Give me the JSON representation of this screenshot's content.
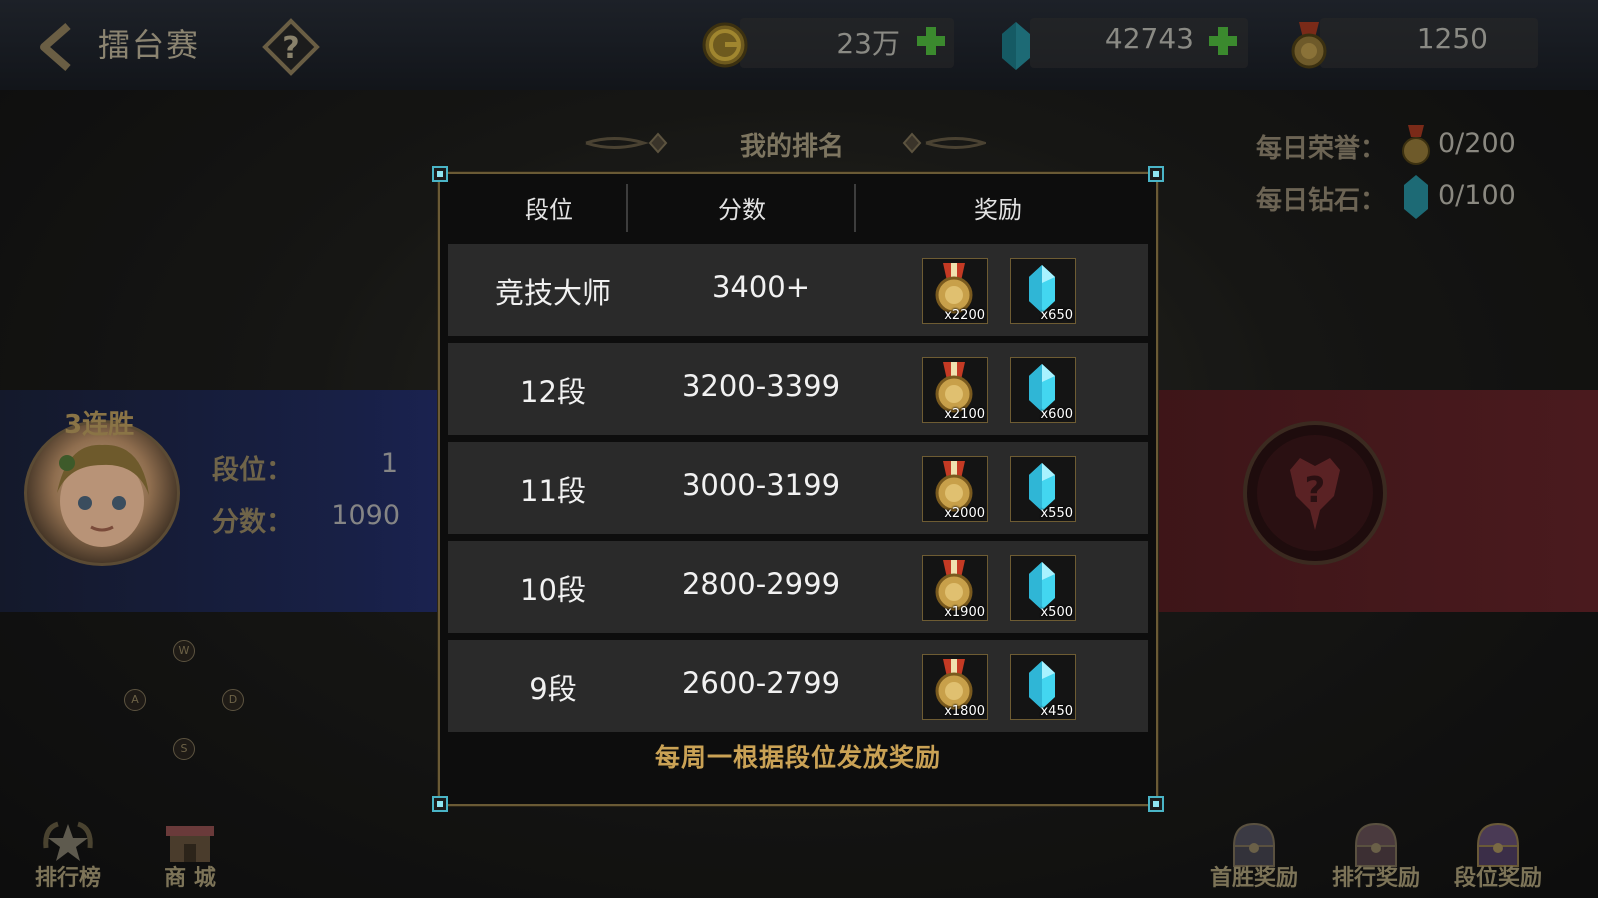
{
  "header": {
    "title": "擂台赛",
    "resources": [
      {
        "icon": "gold-coin-icon",
        "value": "23万"
      },
      {
        "icon": "diamond-icon",
        "value": "42743"
      },
      {
        "icon": "honor-medal-icon",
        "value": "1250"
      }
    ]
  },
  "ranking": {
    "title": "我的排名",
    "daily_honor_label": "每日荣誉：",
    "daily_honor_value": "0/200",
    "daily_diamond_label": "每日钻石：",
    "daily_diamond_value": "0/100"
  },
  "player": {
    "streak": "3连胜",
    "tier_label": "段位：",
    "tier_value": "1",
    "score_label": "分数：",
    "score_value": "1090"
  },
  "joystick": {
    "up": "W",
    "left": "A",
    "right": "D",
    "down": "S"
  },
  "bottom_nav": {
    "left": [
      {
        "label": "排行榜",
        "icon": "star-laurel-icon"
      },
      {
        "label": "商 城",
        "icon": "shop-icon"
      }
    ],
    "right": [
      {
        "label": "首胜奖励",
        "icon": "chest-icon"
      },
      {
        "label": "排行奖励",
        "icon": "chest-icon"
      },
      {
        "label": "段位奖励",
        "icon": "chest-icon"
      }
    ]
  },
  "modal": {
    "columns": [
      "段位",
      "分数",
      "奖励"
    ],
    "rows": [
      {
        "tier": "竞技大师",
        "score": "3400+",
        "medal": "x2200",
        "diamond": "x650"
      },
      {
        "tier": "12段",
        "score": "3200-3399",
        "medal": "x2100",
        "diamond": "x600"
      },
      {
        "tier": "11段",
        "score": "3000-3199",
        "medal": "x2000",
        "diamond": "x550"
      },
      {
        "tier": "10段",
        "score": "2800-2999",
        "medal": "x1900",
        "diamond": "x500"
      },
      {
        "tier": "9段",
        "score": "2600-2799",
        "medal": "x1800",
        "diamond": "x450"
      }
    ],
    "note": "每周一根据段位发放奖励"
  },
  "colors": {
    "accent_gold": "#caa255",
    "border_gold": "#6a5a35",
    "corner_cyan": "#4ab5c7",
    "plus_green": "#3b8a2e"
  }
}
